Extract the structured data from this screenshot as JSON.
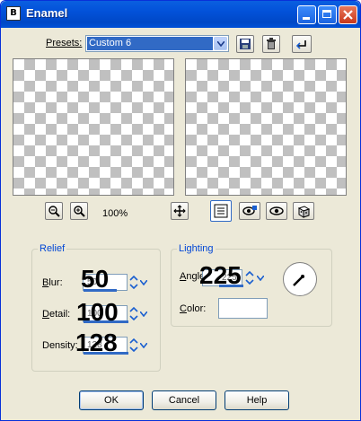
{
  "window": {
    "title": "Enamel",
    "app_icon_letter": "B"
  },
  "titlebar_buttons": {
    "minimize": "minimize",
    "maximize": "maximize",
    "close": "close"
  },
  "presets": {
    "label": "Presets:",
    "value": "Custom 6"
  },
  "toolbar_icons": [
    "save-preset-icon",
    "delete-preset-icon",
    "reset-icon"
  ],
  "preview": {
    "zoom_level": "100%"
  },
  "preview_tools": [
    "zoom-out-icon",
    "zoom-in-icon",
    "pan-icon",
    "proof-toggle-icon",
    "auto-proof-icon",
    "visibility-icon",
    "randomize-icon"
  ],
  "relief": {
    "title": "Relief",
    "blur": {
      "label": "Blur:",
      "underline": "B",
      "rest": "lur:",
      "value": "50",
      "display": "50"
    },
    "detail": {
      "label": "Detail:",
      "underline": "D",
      "rest": "etail:",
      "value": "100",
      "display": "100"
    },
    "density": {
      "label": "Density:",
      "underline": "",
      "rest": "Density:",
      "value": "128",
      "display": "128"
    }
  },
  "lighting": {
    "title": "Lighting",
    "angle": {
      "label": "Angle:",
      "underline": "A",
      "rest": "ngle:",
      "value": "225",
      "display": "225"
    },
    "color": {
      "label": "Color:",
      "underline": "C",
      "rest": "olor:",
      "value": "#ffffff"
    }
  },
  "buttons": {
    "ok": "OK",
    "cancel": "Cancel",
    "help": "Help"
  }
}
